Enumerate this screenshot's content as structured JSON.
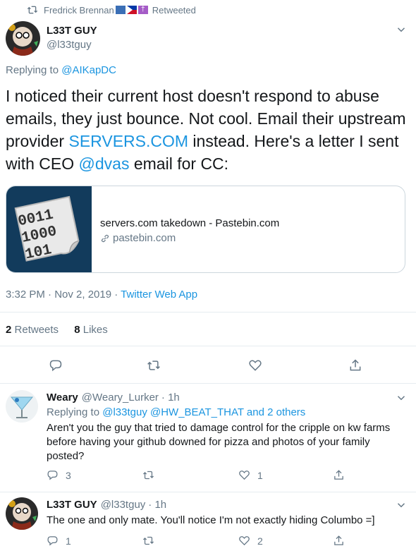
{
  "retweet_header": {
    "user": "Fredrick Brennan",
    "label": "Retweeted"
  },
  "main_tweet": {
    "author_name": "L33T GUY",
    "author_handle": "@l33tguy",
    "replying_to_prefix": "Replying to ",
    "replying_to": "@AIKapDC",
    "text_1": "I noticed their current host doesn't respond to abuse emails, they just bounce. Not cool. Email their upstream provider ",
    "text_link": "SERVERS.COM",
    "text_2": " instead. Here's a letter I sent with CEO ",
    "text_mention": "@dvas",
    "text_3": " email for CC:",
    "card": {
      "thumb_text": [
        "0011",
        "1000",
        "101"
      ],
      "title": "servers.com takedown - Pastebin.com",
      "domain": "pastebin.com"
    },
    "time": "3:32 PM · Nov 2, 2019",
    "sep": " · ",
    "source": "Twitter Web App",
    "retweets_count": "2",
    "retweets_label": "Retweets",
    "likes_count": "8",
    "likes_label": "Likes"
  },
  "replies": [
    {
      "author_name": "Weary",
      "author_handle": "@Weary_Lurker",
      "time": "· 1h",
      "replying_prefix": "Replying to ",
      "replying_to": "@l33tguy @HW_BEAT_THAT and 2 others",
      "text": "Aren't you the guy that tried to damage control for the cripple on kw farms before having your github downed for pizza and photos of your family posted?",
      "reply_count": "3",
      "retweet_count": "",
      "like_count": "1"
    },
    {
      "author_name": "L33T GUY",
      "author_handle": "@l33tguy",
      "time": "· 1h",
      "text": "The one and only mate. You'll notice I'm not exactly hiding Columbo =]",
      "reply_count": "1",
      "retweet_count": "",
      "like_count": "2"
    }
  ],
  "icons": [
    "retweet-icon",
    "chevron-down-icon",
    "link-icon",
    "reply-icon",
    "like-icon",
    "share-icon"
  ],
  "colors": {
    "accent": "#1b95e0",
    "muted": "#657786",
    "divider": "#e6ecf0"
  }
}
